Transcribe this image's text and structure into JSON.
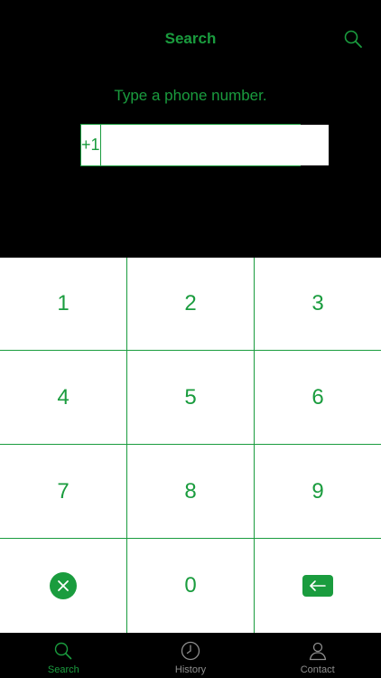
{
  "header": {
    "title": "Search",
    "search_icon": "search-icon"
  },
  "prompt": "Type a phone number.",
  "phone": {
    "prefix": "+1",
    "value": "",
    "placeholder": ""
  },
  "keypad": {
    "keys": [
      "1",
      "2",
      "3",
      "4",
      "5",
      "6",
      "7",
      "8",
      "9"
    ],
    "zero": "0",
    "clear_icon": "clear-x-icon",
    "backspace_icon": "backspace-arrow-icon"
  },
  "tabs": [
    {
      "label": "Search",
      "icon": "search-icon",
      "active": true
    },
    {
      "label": "History",
      "icon": "clock-icon",
      "active": false
    },
    {
      "label": "Contact",
      "icon": "person-icon",
      "active": false
    }
  ],
  "colors": {
    "accent": "#1a9c3e",
    "background": "#000000",
    "keypad_bg": "#ffffff",
    "inactive": "#8e8e8e"
  }
}
